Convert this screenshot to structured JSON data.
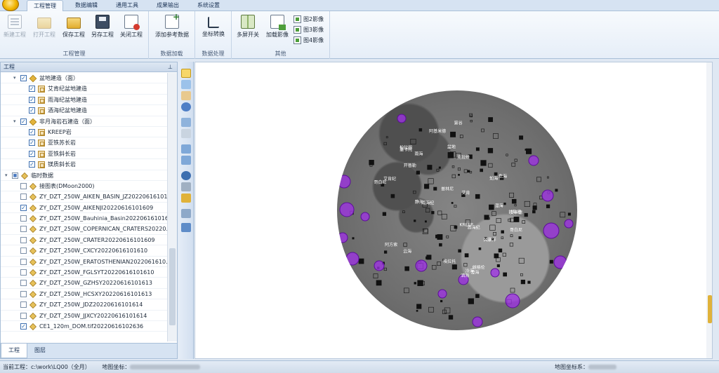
{
  "menu": {
    "tabs": [
      "工程管理",
      "数据编辑",
      "通用工具",
      "成果输出",
      "系统设置"
    ],
    "active": 0
  },
  "ribbon": {
    "groups": [
      {
        "label": "工程管理",
        "buttons": [
          {
            "label": "新建工程",
            "icon": "new-project-icon",
            "enabled": false
          },
          {
            "label": "打开工程",
            "icon": "open-folder-icon",
            "enabled": false
          },
          {
            "label": "保存工程",
            "icon": "save-folder-icon",
            "enabled": true
          },
          {
            "label": "另存工程",
            "icon": "save-disk-icon",
            "enabled": true
          },
          {
            "label": "关闭工程",
            "icon": "close-project-icon",
            "enabled": true
          }
        ]
      },
      {
        "label": "数据加载",
        "buttons": [
          {
            "label": "添加参考数据",
            "icon": "add-reference-icon",
            "enabled": true
          }
        ]
      },
      {
        "label": "数据处理",
        "buttons": [
          {
            "label": "坐标转换",
            "icon": "coordinate-transform-icon",
            "enabled": true
          }
        ]
      },
      {
        "label": "其他",
        "buttons": [
          {
            "label": "多屏开关",
            "icon": "split-screen-icon",
            "enabled": true
          },
          {
            "label": "加载影像",
            "icon": "load-image-icon",
            "enabled": true
          }
        ],
        "small": [
          "图2影像",
          "图3影像",
          "图4影像"
        ]
      }
    ]
  },
  "panel": {
    "title": "工程",
    "tabs": [
      "工程",
      "图层"
    ],
    "active_tab": 0,
    "tree": [
      {
        "indent": 1,
        "exp": "open",
        "checked": true,
        "icon": "diamond",
        "label": "盆地建造（面）"
      },
      {
        "indent": 2,
        "checked": true,
        "icon": "box",
        "label": "艾肯纪盆地建造"
      },
      {
        "indent": 2,
        "checked": true,
        "icon": "box",
        "label": "雨海纪盆地建造"
      },
      {
        "indent": 2,
        "checked": true,
        "icon": "box",
        "label": "酒海纪盆地建造"
      },
      {
        "indent": 1,
        "exp": "open",
        "checked": true,
        "icon": "diamond",
        "label": "非月海岩石建造（面）"
      },
      {
        "indent": 2,
        "checked": true,
        "icon": "box",
        "label": "KREEP岩"
      },
      {
        "indent": 2,
        "checked": true,
        "icon": "box",
        "label": "亚铁苏长岩"
      },
      {
        "indent": 2,
        "checked": true,
        "icon": "box",
        "label": "亚铁斜长岩"
      },
      {
        "indent": 2,
        "checked": true,
        "icon": "box",
        "label": "镁质斜长岩"
      },
      {
        "indent": 0,
        "exp": "open",
        "checked": "partial",
        "icon": "dia2",
        "label": "临时数据"
      },
      {
        "indent": 1,
        "checked": false,
        "icon": "dia2",
        "label": "接图表(DMoon2000)"
      },
      {
        "indent": 1,
        "checked": false,
        "icon": "dia2",
        "label": "ZY_DZT_250W_AIKEN_BASIN_JZ2022061610​1..."
      },
      {
        "indent": 1,
        "checked": true,
        "icon": "dia2",
        "label": "ZY_DZT_250W_AIKENJI20220616101609"
      },
      {
        "indent": 1,
        "checked": false,
        "icon": "dia2",
        "label": "ZY_DZT_250W_Bauhinia_Basin20220616101609"
      },
      {
        "indent": 1,
        "checked": false,
        "icon": "dia2",
        "label": "ZY_DZT_250W_COPERNICAN_CRATERS20220..."
      },
      {
        "indent": 1,
        "checked": false,
        "icon": "dia2",
        "label": "ZY_DZT_250W_CRATER20220616101609"
      },
      {
        "indent": 1,
        "checked": false,
        "icon": "dia2",
        "label": "ZY_DZT_250W_CXCY20220616101610"
      },
      {
        "indent": 1,
        "checked": false,
        "icon": "dia2",
        "label": "ZY_DZT_250W_ERATOSTHENIAN2022061610..."
      },
      {
        "indent": 1,
        "checked": false,
        "icon": "dia2",
        "label": "ZY_DZT_250W_FGLSYT20220616101610"
      },
      {
        "indent": 1,
        "checked": false,
        "icon": "dia2",
        "label": "ZY_DZT_250W_GZHSY20220616101613"
      },
      {
        "indent": 1,
        "checked": false,
        "icon": "dia2",
        "label": "ZY_DZT_250W_HCSXY20220616101613"
      },
      {
        "indent": 1,
        "checked": false,
        "icon": "dia2",
        "label": "ZY_DZT_250W_JDZ20220616101614"
      },
      {
        "indent": 1,
        "checked": false,
        "icon": "dia2",
        "label": "ZY_DZT_250W_JJXCY20220616101614"
      },
      {
        "indent": 1,
        "checked": true,
        "icon": "dia2",
        "label": "CE1_120m_DOM.tif20220616102636"
      }
    ]
  },
  "map_labels": [
    "艾肯纪",
    "盆地",
    "雨海纪",
    "酒海纪",
    "哥白尼",
    "KREEP",
    "酒海",
    "雨海",
    "静海",
    "澄海",
    "危海",
    "湿海",
    "云海",
    "冷海",
    "知海",
    "风暴洋",
    "第谷",
    "开普勒",
    "阿基米德",
    "托勒密",
    "阿方索",
    "哥白尼",
    "埃拉托",
    "柏拉图",
    "艾肯",
    "克拉维",
    "墨卡托",
    "朗格伦",
    "皮卡德",
    "普林尼"
  ],
  "status": {
    "project_label": "当前工程：",
    "project_value": "c:\\work\\LQ00（全月）",
    "map_label": "地图坐标：",
    "crs_label": "地图坐标系："
  },
  "colors": {
    "accent": "#a030e8",
    "menubar": "#d6e3f2"
  }
}
